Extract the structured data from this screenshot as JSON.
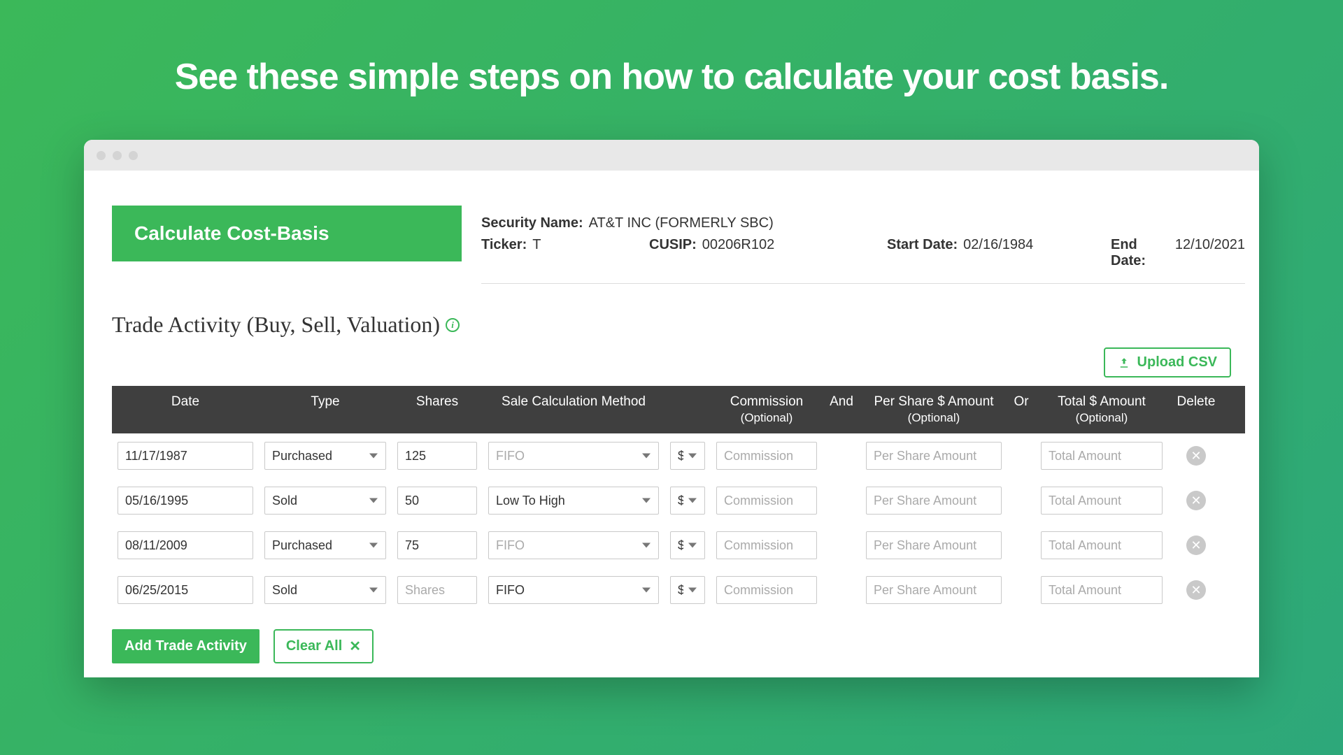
{
  "hero": "See these simple steps on how to calculate your cost basis.",
  "banner": "Calculate Cost-Basis",
  "meta": {
    "securityNameLabel": "Security Name:",
    "securityName": "AT&T INC (FORMERLY SBC)",
    "tickerLabel": "Ticker:",
    "ticker": "T",
    "cusipLabel": "CUSIP:",
    "cusip": "00206R102",
    "startDateLabel": "Start Date:",
    "startDate": "02/16/1984",
    "endDateLabel": "End Date:",
    "endDate": "12/10/2021"
  },
  "sectionTitle": "Trade Activity (Buy, Sell, Valuation)",
  "uploadLabel": "Upload CSV",
  "columns": {
    "date": "Date",
    "type": "Type",
    "shares": "Shares",
    "method": "Sale Calculation Method",
    "commission": "Commission",
    "commissionSub": "(Optional)",
    "and": "And",
    "perShare": "Per Share $ Amount",
    "perShareSub": "(Optional)",
    "or": "Or",
    "total": "Total $ Amount",
    "totalSub": "(Optional)",
    "del": "Delete"
  },
  "placeholders": {
    "shares": "Shares",
    "commission": "Commission",
    "perShare": "Per Share Amount",
    "total": "Total Amount"
  },
  "currency": "$",
  "rows": [
    {
      "date": "11/17/1987",
      "type": "Purchased",
      "shares": "125",
      "method": "FIFO",
      "methodDisabled": true
    },
    {
      "date": "05/16/1995",
      "type": "Sold",
      "shares": "50",
      "method": "Low To High",
      "methodDisabled": false
    },
    {
      "date": "08/11/2009",
      "type": "Purchased",
      "shares": "75",
      "method": "FIFO",
      "methodDisabled": true
    },
    {
      "date": "06/25/2015",
      "type": "Sold",
      "shares": "",
      "method": "FIFO",
      "methodDisabled": false
    }
  ],
  "actions": {
    "add": "Add Trade Activity",
    "clear": "Clear All"
  }
}
